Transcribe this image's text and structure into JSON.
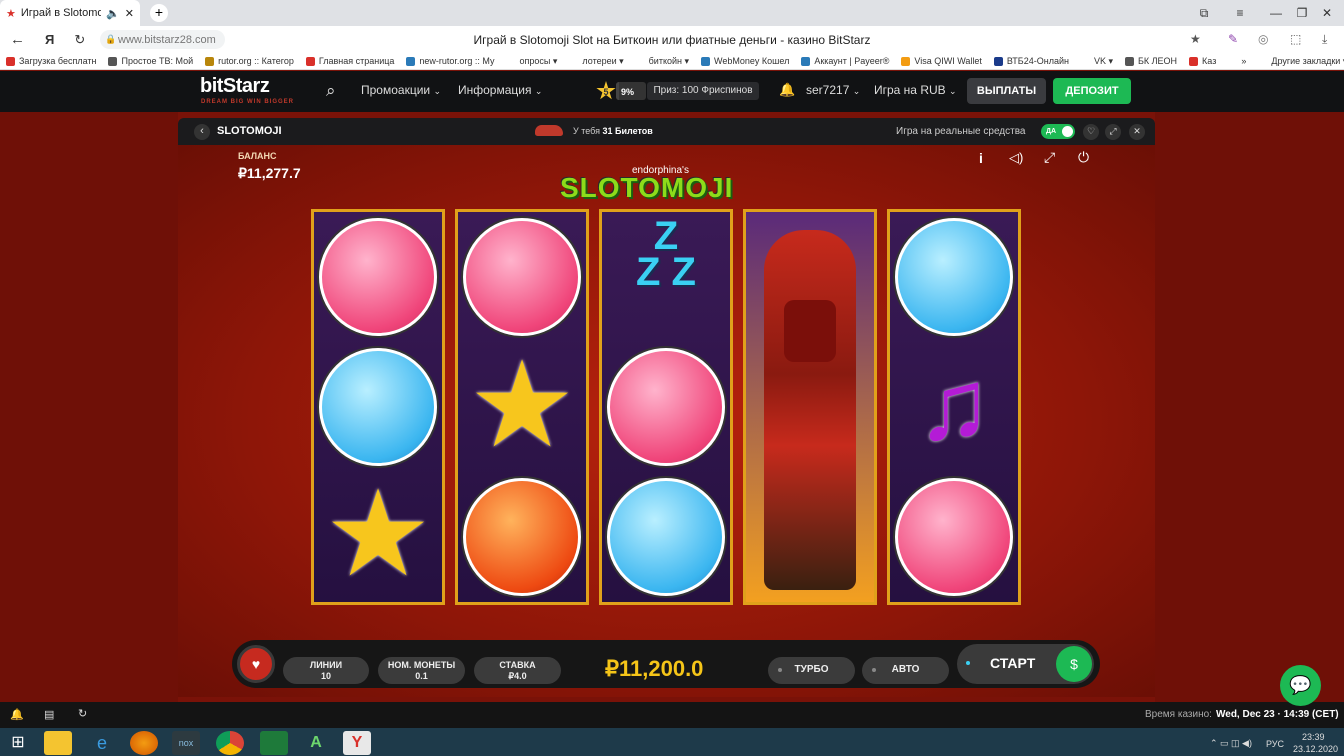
{
  "browser": {
    "tab_title": "Играй в Slotomoji Sl",
    "url": "www.bitstarz28.com",
    "page_title": "Играй в Slotomoji Slot на Биткоин или фиатные деньги - казино BitStarz",
    "bookmarks": [
      {
        "label": "Загрузка бесплатн",
        "color": "#d9302a"
      },
      {
        "label": "Простое ТВ: Мой",
        "color": "#555"
      },
      {
        "label": "rutor.org :: Категор",
        "color": "#b8860b"
      },
      {
        "label": "Главная страница",
        "color": "#d9302a"
      },
      {
        "label": "new-rutor.org :: Му",
        "color": "#2a7ab8"
      },
      {
        "label": "опросы ▾",
        "color": "#fff"
      },
      {
        "label": "лотереи ▾",
        "color": "#fff"
      },
      {
        "label": "биткойн ▾",
        "color": "#fff"
      },
      {
        "label": "WebMoney Кошел",
        "color": "#2a7ab8"
      },
      {
        "label": "Аккаунт | Payeer®",
        "color": "#2a7ab8"
      },
      {
        "label": "Visa QIWI Wallet",
        "color": "#f39c12"
      },
      {
        "label": "ВТБ24-Онлайн",
        "color": "#1a3a8a"
      },
      {
        "label": "VK ▾",
        "color": "#fff"
      },
      {
        "label": "БК ЛЕОН",
        "color": "#555"
      },
      {
        "label": "Каз",
        "color": "#d9302a"
      },
      {
        "label": "»",
        "color": "#fff"
      },
      {
        "label": "Другие закладки ▾",
        "color": "#fff"
      }
    ]
  },
  "site": {
    "logo": "bitStarz",
    "tagline": "DREAM BIG  WIN BIGGER",
    "nav_promotions": "Промоакции",
    "nav_info": "Информация",
    "level": "5",
    "progress_label": "9%",
    "progress": 0.09,
    "prize": "Приз: 100 Фриспинов",
    "username": "ser7217",
    "play_currency": "Игра на RUB",
    "withdraw": "ВЫПЛАТЫ",
    "deposit": "ДЕПОЗИТ"
  },
  "game": {
    "title": "SLOTOMOJI",
    "tickets_prefix": "У тебя",
    "tickets": "31 Билетов",
    "real_money_label": "Игра на реальные средства",
    "toggle": "ДА",
    "balance_label": "БАЛАНС",
    "balance": "₽11,277.7",
    "brand": "endorphina's",
    "logo_text": "SLOTOMOJI",
    "lines_label": "ЛИНИИ",
    "lines": "10",
    "coin_label": "НОМ. МОНЕТЫ",
    "coin": "0.1",
    "bet_label": "СТАВКА",
    "bet": "₽4.0",
    "credit": "₽11,200.0",
    "turbo": "ТУРБО",
    "auto": "АВТО",
    "start": "СТАРТ"
  },
  "footer": {
    "time_label": "Время казино:",
    "time": "Wed, Dec 23 · 14:39 (CET)",
    "clock": "23:39",
    "date": "23.12.2020",
    "lang": "РУС"
  }
}
